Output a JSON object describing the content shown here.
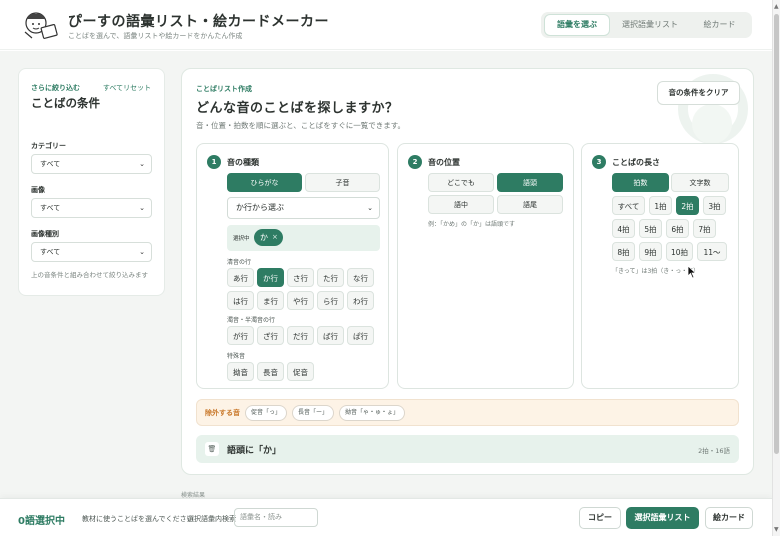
{
  "header": {
    "title": "ぴーすの語彙リスト・絵カードメーカー",
    "subtitle": "ことばを選んで、語彙リストや絵カードをかんたん作成",
    "nav": [
      {
        "label": "語彙を選ぶ",
        "active": true
      },
      {
        "label": "選択語彙リスト",
        "active": false
      },
      {
        "label": "絵カード",
        "active": false
      }
    ]
  },
  "sidebar": {
    "kicker": "さらに絞り込む",
    "title": "ことばの条件",
    "reset": "すべてリセット",
    "filters": [
      {
        "label": "カテゴリー",
        "value": "すべて"
      },
      {
        "label": "画像",
        "value": "すべて"
      },
      {
        "label": "画像種別",
        "value": "すべて"
      }
    ],
    "note": "上の音条件と組み合わせて絞り込みます"
  },
  "main": {
    "kicker": "ことばリスト作成",
    "title": "どんな音のことばを探しますか？",
    "subtitle": "音・位置・拍数を順に選ぶと、ことばをすぐに一覧できます。",
    "clear_button": "音の条件をクリア",
    "panel1": {
      "num": "1",
      "title": "音の種類",
      "tabs": [
        "ひらがな",
        "子音"
      ],
      "row_select": "か行から選ぶ",
      "selected_label": "選択中",
      "selected_value": "か",
      "selected_remove": "×",
      "clear_label": "清音の行",
      "clear_rows": [
        "あ行",
        "か行",
        "さ行",
        "た行",
        "な行",
        "は行",
        "ま行",
        "や行",
        "ら行",
        "わ行"
      ],
      "voiced_label": "濁音・半濁音の行",
      "voiced_rows": [
        "が行",
        "ざ行",
        "だ行",
        "ば行",
        "ぱ行"
      ],
      "special_label": "特殊音",
      "special": [
        "拗音",
        "長音",
        "促音"
      ]
    },
    "panel2": {
      "num": "2",
      "title": "音の位置",
      "options": [
        "どこでも",
        "語頭",
        "語中",
        "語尾"
      ],
      "note": "例：「かめ」の「か」は語頭です"
    },
    "panel3": {
      "num": "3",
      "title": "ことばの長さ",
      "tabs": [
        "拍数",
        "文字数"
      ],
      "options": [
        "すべて",
        "1拍",
        "2拍",
        "3拍",
        "4拍",
        "5拍",
        "6拍",
        "7拍",
        "8拍",
        "9拍",
        "10拍",
        "11〜"
      ],
      "note": "「きって」は3拍（き・っ・て）"
    },
    "exclude": {
      "label": "除外する音",
      "chips": [
        "促音「っ」",
        "長音「ー」",
        "拗音「ゃ・ゅ・ょ」"
      ]
    },
    "result": {
      "title": "語頭に「か」",
      "count": "2拍・16語"
    },
    "peek": "検索結果"
  },
  "bottom": {
    "count": "0語選択中",
    "hint": "教材に使うことばを選んでください",
    "search_label": "選択語彙内検索",
    "search_placeholder": "語彙名・読み",
    "copy": "コピー",
    "list": "選択語彙リスト",
    "cards": "絵カード"
  },
  "colors": {
    "accent": "#2e7c63",
    "accent_light": "#e7f2ec",
    "warning_bg": "#fdf3e6"
  }
}
